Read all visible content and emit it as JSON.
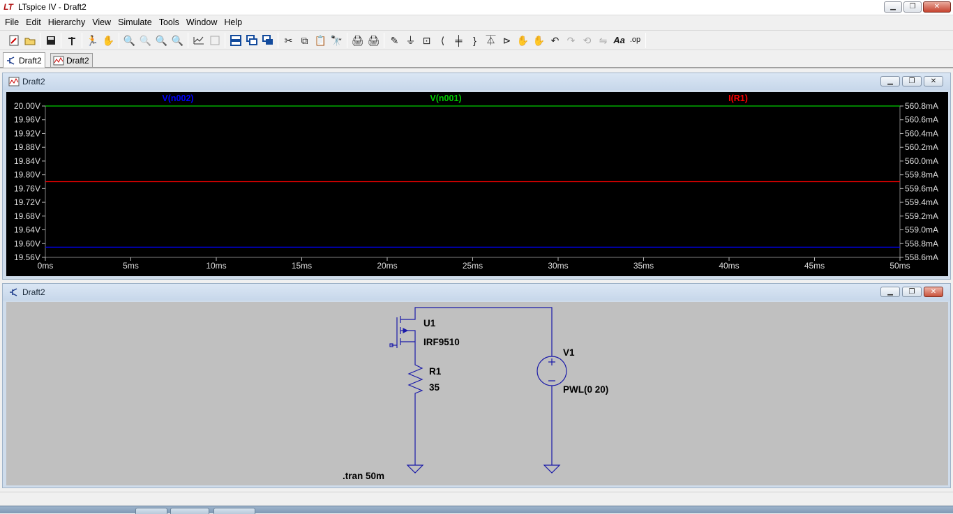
{
  "app": {
    "title": "LTspice IV - Draft2"
  },
  "menu": [
    "File",
    "Edit",
    "Hierarchy",
    "View",
    "Simulate",
    "Tools",
    "Window",
    "Help"
  ],
  "toolbar_icons": [
    "new-schematic",
    "open",
    "save",
    "control-panel",
    "run",
    "halt",
    "zoom-in",
    "zoom-pan",
    "zoom-out",
    "zoom-fit",
    "autorange",
    "cursor-grid",
    "tile-horizontal",
    "cascade",
    "close-all",
    "cut",
    "copy",
    "paste",
    "find",
    "print-setup",
    "print",
    "draw-wire",
    "ground",
    "label-net",
    "resistor",
    "capacitor",
    "inductor",
    "diode",
    "component",
    "move",
    "drag",
    "undo",
    "redo",
    "rotate",
    "mirror",
    "text",
    "spice-directive"
  ],
  "tabs": [
    {
      "label": "Draft2",
      "kind": "schematic"
    },
    {
      "label": "Draft2",
      "kind": "waveform"
    }
  ],
  "plot_window": {
    "title": "Draft2"
  },
  "schematic_window": {
    "title": "Draft2"
  },
  "chart_data": {
    "type": "line",
    "series": [
      {
        "name": "V(n002)",
        "color": "#0000ff",
        "axis": "left",
        "x": [
          0,
          50
        ],
        "y": [
          19.5896,
          19.5896
        ]
      },
      {
        "name": "V(n001)",
        "color": "#00cc00",
        "axis": "left",
        "x": [
          0,
          50
        ],
        "y": [
          20.0,
          20.0
        ]
      },
      {
        "name": "I(R1)",
        "color": "#ff0000",
        "axis": "right",
        "x": [
          0,
          50
        ],
        "y": [
          559.7,
          559.7
        ]
      }
    ],
    "x_ticks": [
      "0ms",
      "5ms",
      "10ms",
      "15ms",
      "20ms",
      "25ms",
      "30ms",
      "35ms",
      "40ms",
      "45ms",
      "50ms"
    ],
    "xlim": [
      0,
      50
    ],
    "y_left_ticks": [
      "20.00V",
      "19.96V",
      "19.92V",
      "19.88V",
      "19.84V",
      "19.80V",
      "19.76V",
      "19.72V",
      "19.68V",
      "19.64V",
      "19.60V",
      "19.56V"
    ],
    "ylim_left": [
      19.56,
      20.0
    ],
    "y_right_ticks": [
      "560.8mA",
      "560.6mA",
      "560.4mA",
      "560.2mA",
      "560.0mA",
      "559.8mA",
      "559.6mA",
      "559.4mA",
      "559.2mA",
      "559.0mA",
      "558.8mA",
      "558.6mA"
    ],
    "ylim_right": [
      558.6,
      560.8
    ],
    "grid": false
  },
  "schematic": {
    "u1_name": "U1",
    "u1_value": "IRF9510",
    "r1_name": "R1",
    "r1_value": "35",
    "v1_name": "V1",
    "v1_value": "PWL(0 20)",
    "directive": ".tran 50m"
  }
}
